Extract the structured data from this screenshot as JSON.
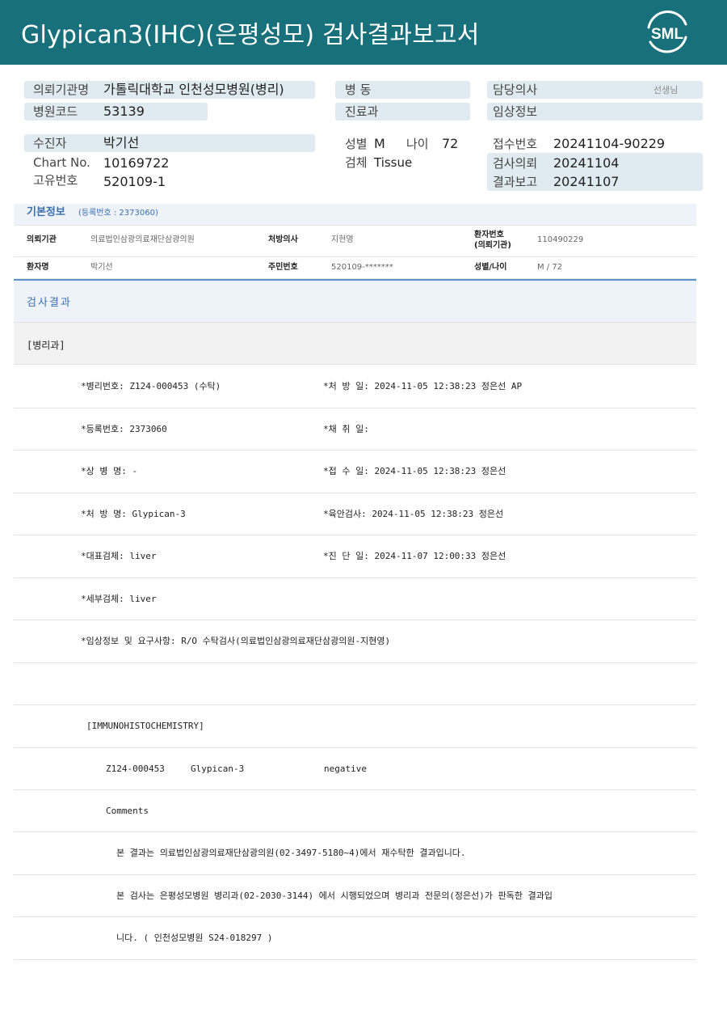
{
  "header": {
    "title": "Glypican3(IHC)(은평성모) 검사결과보고서",
    "logo_text": "SML",
    "bg_color": "#17707a"
  },
  "top": {
    "requesting_org_label": "의뢰기관명",
    "requesting_org_value": "가톨릭대학교 인천성모병원(병리)",
    "hospital_code_label": "병원코드",
    "hospital_code_value": "53139",
    "ward_label": "병 동",
    "department_label": "진료과",
    "doctor_label": "담당의사",
    "doctor_suffix": "선생님",
    "clinical_info_label": "임상정보",
    "patient_label": "수진자",
    "patient_value": "박기선",
    "chart_label": "Chart No.",
    "chart_value": "10169722",
    "unique_label": "고유번호",
    "unique_value": "520109-1",
    "sex_label": "성별",
    "sex_value": "M",
    "age_label": "나이",
    "age_value": "72",
    "specimen_label": "검체",
    "specimen_value": "Tissue",
    "receipt_label": "접수번호",
    "receipt_value": "20241104-90229",
    "request_label": "검사의뢰",
    "request_value": "20241104",
    "report_label": "결과보고",
    "report_value": "20241107"
  },
  "basic": {
    "title": "기본정보",
    "reg_no": "(등록번호 : 2373060)",
    "row1": {
      "org_label": "의뢰기관",
      "org_value": "의료법인삼광의료재단삼광의원",
      "prescriber_label": "처방의사",
      "prescriber_value": "지현영",
      "patno_label": "환자번호\n(의뢰기관)",
      "patno_label_1": "환자번호",
      "patno_label_2": "(의뢰기관)",
      "patno_value": "110490229"
    },
    "row2": {
      "name_label": "환자명",
      "name_value": "박기선",
      "rrn_label": "주민번호",
      "rrn_value": "520109-*******",
      "sexage_label": "성별/나이",
      "sexage_value": "M / 72"
    }
  },
  "result": {
    "title": "검사결과",
    "dept": "[병리과]",
    "lines": [
      {
        "left": "*병리번호: Z124-000453 (수탁)",
        "right": "*처 방 일: 2024-11-05 12:38:23  정은선 AP"
      },
      {
        "left": "*등록번호: 2373060",
        "right": "*채 취 일:"
      },
      {
        "left": "*상 병 명: -",
        "right": "*접 수 일: 2024-11-05 12:38:23  정은선"
      },
      {
        "left": "*처 방 명: Glypican-3",
        "right": "*육안검사: 2024-11-05 12:38:23  정은선"
      },
      {
        "left": "*대표검체: liver",
        "right": "*진 단 일: 2024-11-07 12:00:33  정은선"
      },
      {
        "left": "*세부검체: liver",
        "right": ""
      },
      {
        "left": "*임상정보 및 요구사항: R/O 수탁검사(의료법인삼광의료재단삼광의원-지현영)",
        "right": ""
      },
      {
        "left": "",
        "right": ""
      },
      {
        "left": "[IMMUNOHISTOCHEMISTRY]",
        "right": ""
      }
    ],
    "ihc": {
      "case": "Z124-000453",
      "marker": "Glypican-3",
      "result": "negative"
    },
    "comments_label": "Comments",
    "comment_1": "본 결과는 의료법인삼광의료재단삼광의원(02-3497-5180~4)에서 재수탁한 결과입니다.",
    "comment_2": "본 검사는 은평성모병원 병리과(02-2030-3144) 에서 시행되었으며 병리과 전문의(정은선)가 판독한 결과입",
    "comment_3": "니다. ( 인천성모병원 S24-018297 )"
  }
}
